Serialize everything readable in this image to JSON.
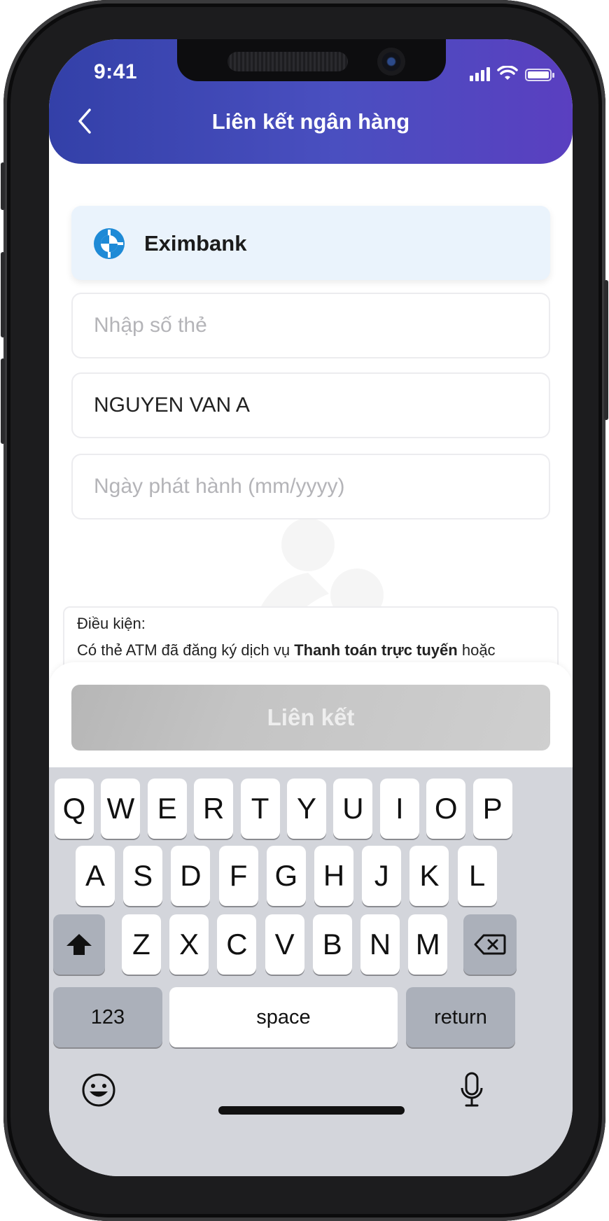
{
  "status_bar": {
    "time": "9:41"
  },
  "header": {
    "title": "Liên kết ngân hàng",
    "back_icon": "chevron-left-icon"
  },
  "bank": {
    "name": "Eximbank",
    "logo_icon": "eximbank-logo-icon"
  },
  "form": {
    "card_number": {
      "value": "",
      "placeholder": "Nhập số thẻ"
    },
    "card_holder": {
      "value": "NGUYEN VAN A",
      "placeholder": ""
    },
    "issue_date": {
      "value": "",
      "placeholder": "Ngày phát hành (mm/yyyy)"
    }
  },
  "terms": {
    "heading": "Điều kiện:",
    "line_prefix": "Có thẻ ATM đã đăng ký dịch vụ",
    "line_bold": "Thanh toán trực tuyến",
    "line_suffix": "hoặc"
  },
  "submit_label": "Liên kết",
  "keyboard": {
    "row1": [
      "Q",
      "W",
      "E",
      "R",
      "T",
      "Y",
      "U",
      "I",
      "O",
      "P"
    ],
    "row2": [
      "A",
      "S",
      "D",
      "F",
      "G",
      "H",
      "J",
      "K",
      "L"
    ],
    "row3": [
      "Z",
      "X",
      "C",
      "V",
      "B",
      "N",
      "M"
    ],
    "numbers_key": "123",
    "space_key": "space",
    "return_key": "return"
  },
  "colors": {
    "header_start": "#3340a8",
    "header_end": "#5a3fc0",
    "bank_card_bg": "#eaf3fc",
    "button_disabled": "#c4c4c4",
    "keyboard_bg": "#d3d5db"
  }
}
